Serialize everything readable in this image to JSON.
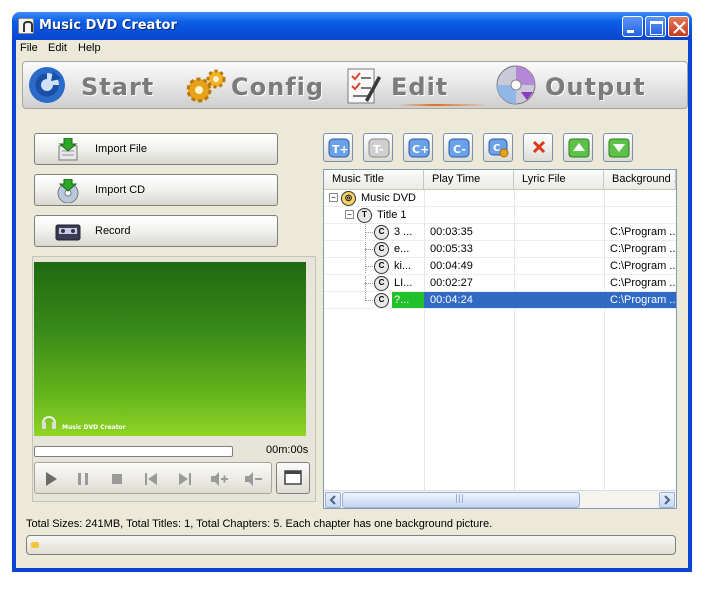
{
  "window": {
    "title": "Music DVD Creator"
  },
  "menu": [
    "File",
    "Edit",
    "Help"
  ],
  "steps": [
    {
      "label": "Start",
      "icon": "start-refresh-icon"
    },
    {
      "label": "Config",
      "icon": "gears-icon"
    },
    {
      "label": "Edit",
      "icon": "edit-checklist-icon",
      "active": true
    },
    {
      "label": "Output",
      "icon": "disc-icon"
    }
  ],
  "left": {
    "import_file": "Import File",
    "import_cd": "Import CD",
    "record": "Record",
    "preview_caption": "Music DVD Creator",
    "time": "00m:00s",
    "progress": 0
  },
  "toolbar": [
    "add-title-icon",
    "remove-title-icon",
    "add-chapter-icon",
    "remove-chapter-icon",
    "chapter-settings-icon",
    "delete-icon",
    "move-up-icon",
    "move-down-icon"
  ],
  "table": {
    "columns": [
      "Music Title",
      "Play Time",
      "Lyric File",
      "Background ..."
    ],
    "root": "Music DVD",
    "title": "Title 1",
    "chapters": [
      {
        "name": "3 ...",
        "time": "00:03:35",
        "lyric": "",
        "background": "C:\\Program ..."
      },
      {
        "name": "e...",
        "time": "00:05:33",
        "lyric": "",
        "background": "C:\\Program ..."
      },
      {
        "name": "ki...",
        "time": "00:04:49",
        "lyric": "",
        "background": "C:\\Program ..."
      },
      {
        "name": "LI...",
        "time": "00:02:27",
        "lyric": "",
        "background": "C:\\Program ..."
      },
      {
        "name": "?...",
        "time": "00:04:24",
        "lyric": "",
        "background": "C:\\Program ...",
        "selected": true
      }
    ],
    "scroll_thumb": "|||"
  },
  "status": "Total Sizes: 241MB, Total Titles: 1, Total Chapters: 5. Each chapter has one background picture.",
  "colors": {
    "titlebar": "#0a4fd6",
    "selection": "#316ac5",
    "chapter_highlight": "#22c12c"
  }
}
